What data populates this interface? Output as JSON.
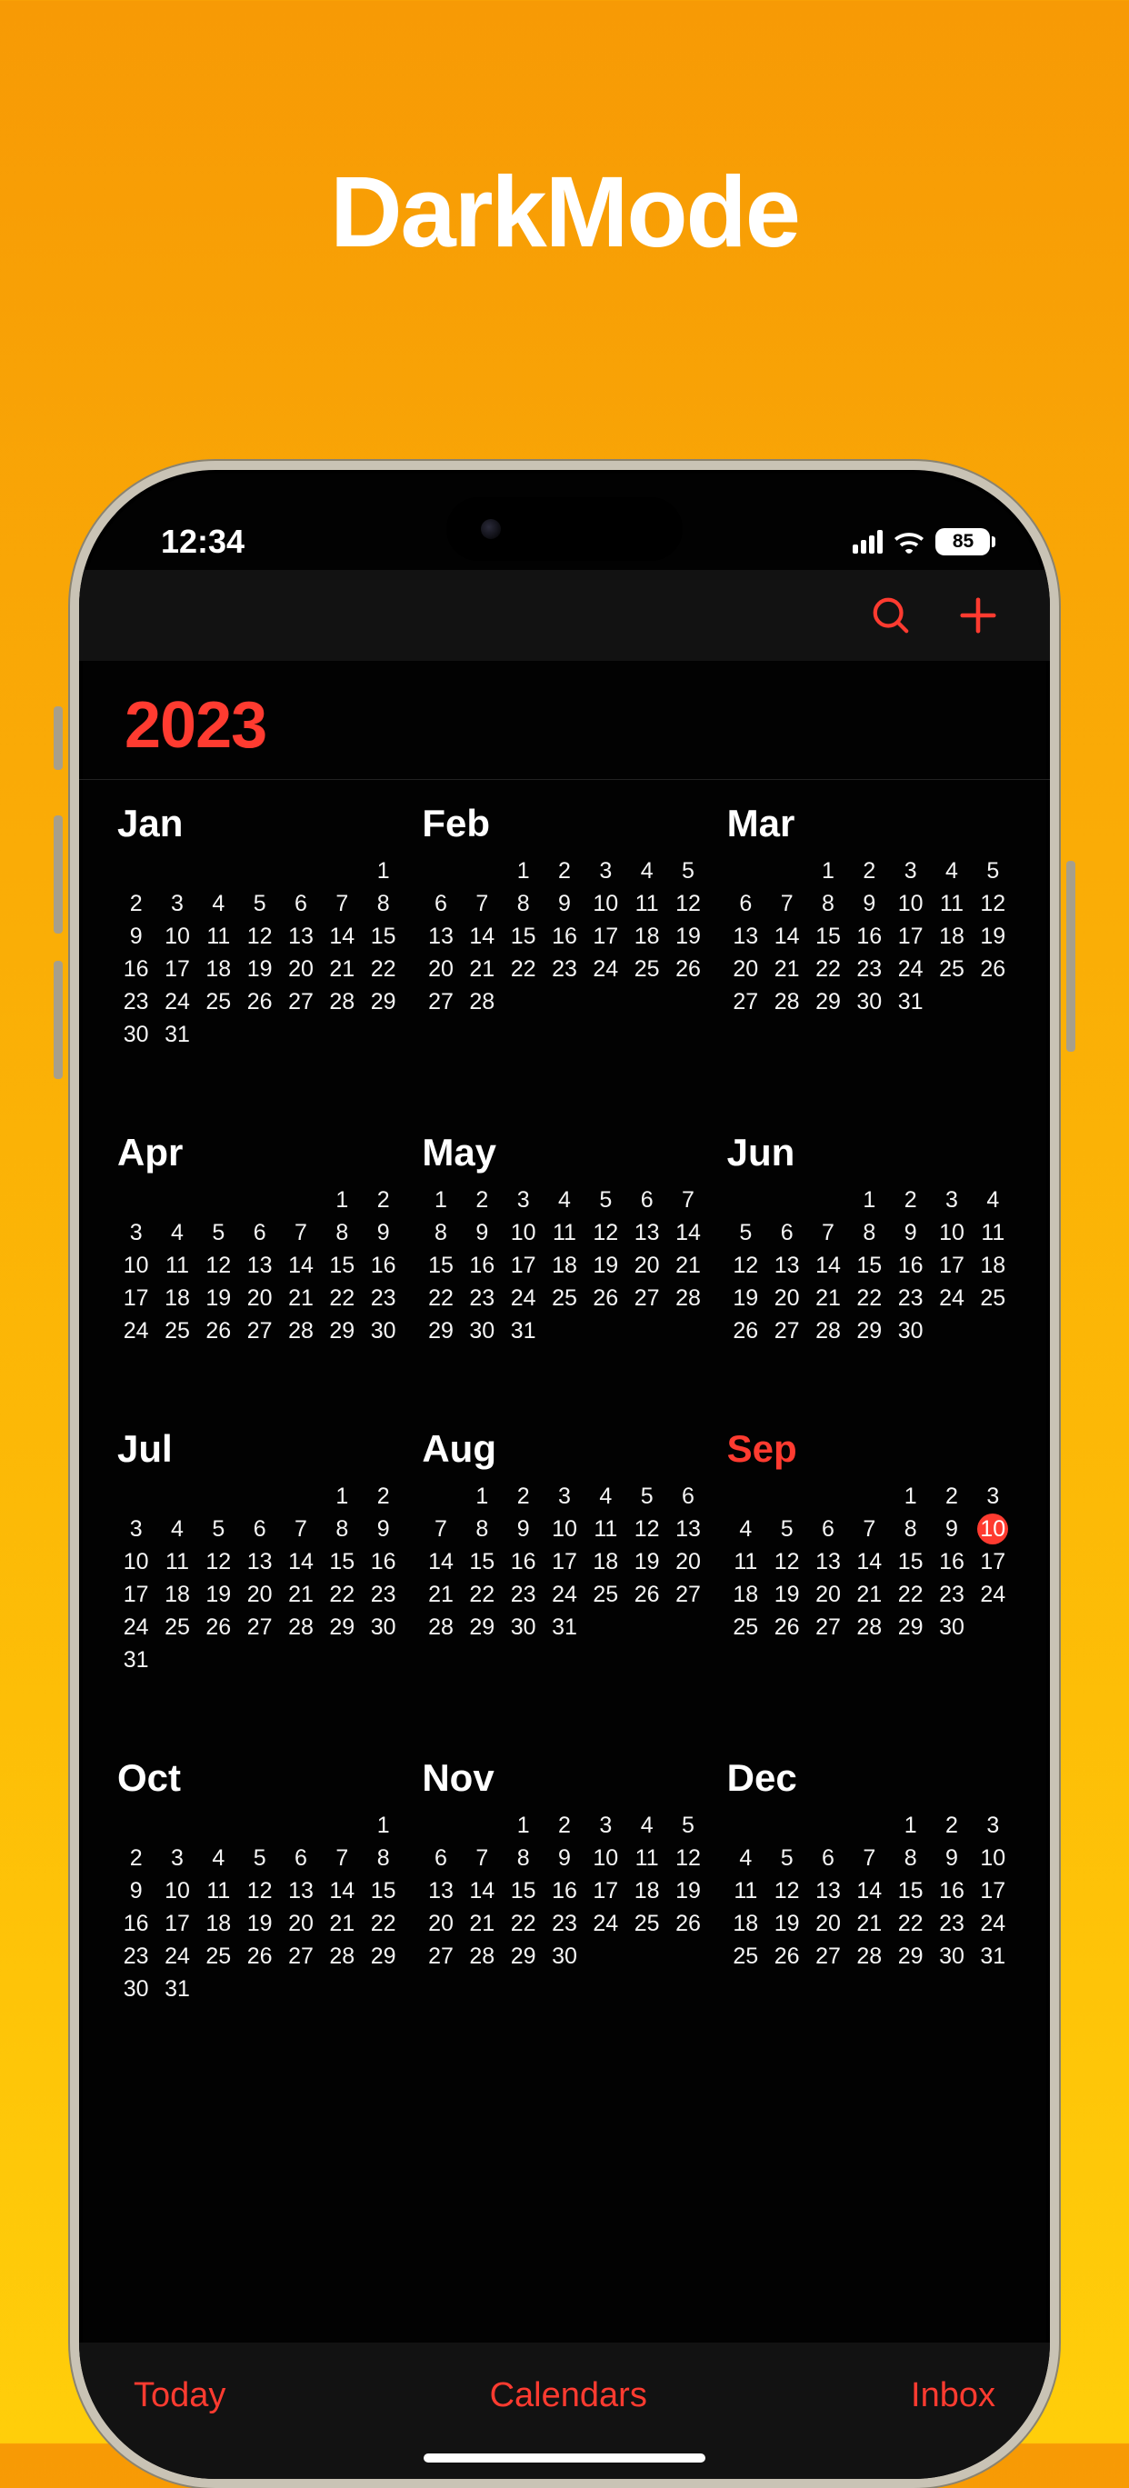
{
  "promo": {
    "title": "DarkMode"
  },
  "status": {
    "time": "12:34",
    "battery_percent": "85"
  },
  "accent_color": "#ff3b30",
  "year": "2023",
  "today": {
    "month_index": 8,
    "day": 10
  },
  "current_month_index": 8,
  "months": [
    {
      "label": "Jan",
      "first_day_of_week": 6,
      "num_days": 31
    },
    {
      "label": "Feb",
      "first_day_of_week": 2,
      "num_days": 28
    },
    {
      "label": "Mar",
      "first_day_of_week": 2,
      "num_days": 31
    },
    {
      "label": "Apr",
      "first_day_of_week": 5,
      "num_days": 30
    },
    {
      "label": "May",
      "first_day_of_week": 0,
      "num_days": 31
    },
    {
      "label": "Jun",
      "first_day_of_week": 3,
      "num_days": 30
    },
    {
      "label": "Jul",
      "first_day_of_week": 5,
      "num_days": 31
    },
    {
      "label": "Aug",
      "first_day_of_week": 1,
      "num_days": 31
    },
    {
      "label": "Sep",
      "first_day_of_week": 4,
      "num_days": 30
    },
    {
      "label": "Oct",
      "first_day_of_week": 6,
      "num_days": 31
    },
    {
      "label": "Nov",
      "first_day_of_week": 2,
      "num_days": 30
    },
    {
      "label": "Dec",
      "first_day_of_week": 4,
      "num_days": 31
    }
  ],
  "bottom_buttons": {
    "today": "Today",
    "calendars": "Calendars",
    "inbox": "Inbox"
  }
}
